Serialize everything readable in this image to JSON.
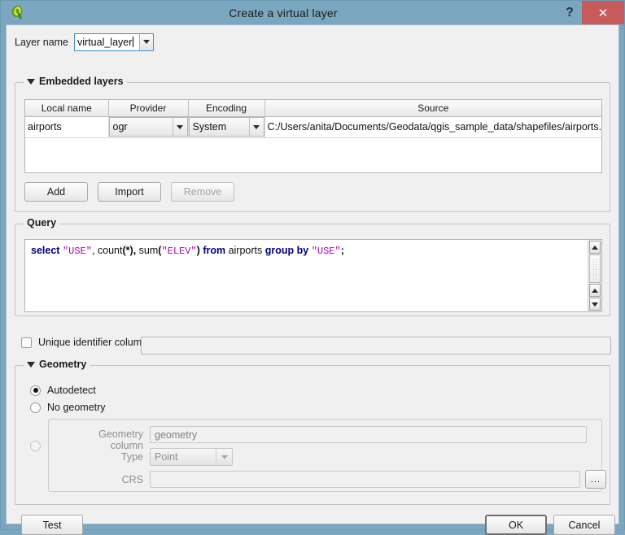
{
  "window": {
    "title": "Create a virtual layer",
    "icon": "qgis-logo-icon",
    "help_label": "?",
    "close_label": "✕"
  },
  "layer_name": {
    "label": "Layer name",
    "value": "virtual_layer",
    "placeholder": ""
  },
  "embedded_layers": {
    "group_title": "Embedded layers",
    "columns": [
      "Local name",
      "Provider",
      "Encoding",
      "Source"
    ],
    "rows": [
      {
        "local_name": "airports",
        "provider": "ogr",
        "encoding": "System",
        "source": "C:/Users/anita/Documents/Geodata/qgis_sample_data/shapefiles/airports.shp"
      }
    ],
    "buttons": {
      "add": "Add",
      "import": "Import",
      "remove": "Remove"
    }
  },
  "query": {
    "group_title": "Query",
    "sql_text": "select \"USE\", count(*), sum(\"ELEV\") from airports group by \"USE\";",
    "tokens": [
      {
        "t": "select",
        "k": "kw"
      },
      {
        "t": " ",
        "k": "id"
      },
      {
        "t": "\"USE\"",
        "k": "str"
      },
      {
        "t": ", ",
        "k": "id"
      },
      {
        "t": "count",
        "k": "fn"
      },
      {
        "t": "(",
        "k": "punc"
      },
      {
        "t": "*",
        "k": "punc"
      },
      {
        "t": "), ",
        "k": "punc"
      },
      {
        "t": "sum",
        "k": "fn"
      },
      {
        "t": "(",
        "k": "punc"
      },
      {
        "t": "\"ELEV\"",
        "k": "str"
      },
      {
        "t": ")",
        "k": "punc"
      },
      {
        "t": " ",
        "k": "id"
      },
      {
        "t": "from",
        "k": "kw"
      },
      {
        "t": " airports ",
        "k": "id"
      },
      {
        "t": "group by",
        "k": "kw"
      },
      {
        "t": " ",
        "k": "id"
      },
      {
        "t": "\"USE\"",
        "k": "str"
      },
      {
        "t": ";",
        "k": "punc"
      }
    ]
  },
  "unique_identifier": {
    "label": "Unique identifier column",
    "checked": false,
    "value": ""
  },
  "geometry": {
    "group_title": "Geometry",
    "options": [
      {
        "label": "Autodetect",
        "selected": true
      },
      {
        "label": "No geometry",
        "selected": false
      },
      {
        "label": "",
        "selected": false
      }
    ],
    "custom": {
      "geometry_column_label": "Geometry column",
      "geometry_column_value": "geometry",
      "type_label": "Type",
      "type_value": "Point",
      "crs_label": "CRS",
      "crs_value": "",
      "browse_label": "..."
    }
  },
  "footer": {
    "test": "Test",
    "ok": "OK",
    "cancel": "Cancel"
  },
  "colors": {
    "title_bar": "#7aa7bf",
    "close_button": "#c75b5b",
    "dialog_bg": "#f0f0f0",
    "keyword": "#000080",
    "string": "#b000b0",
    "focus_border": "#3c8fd4"
  }
}
